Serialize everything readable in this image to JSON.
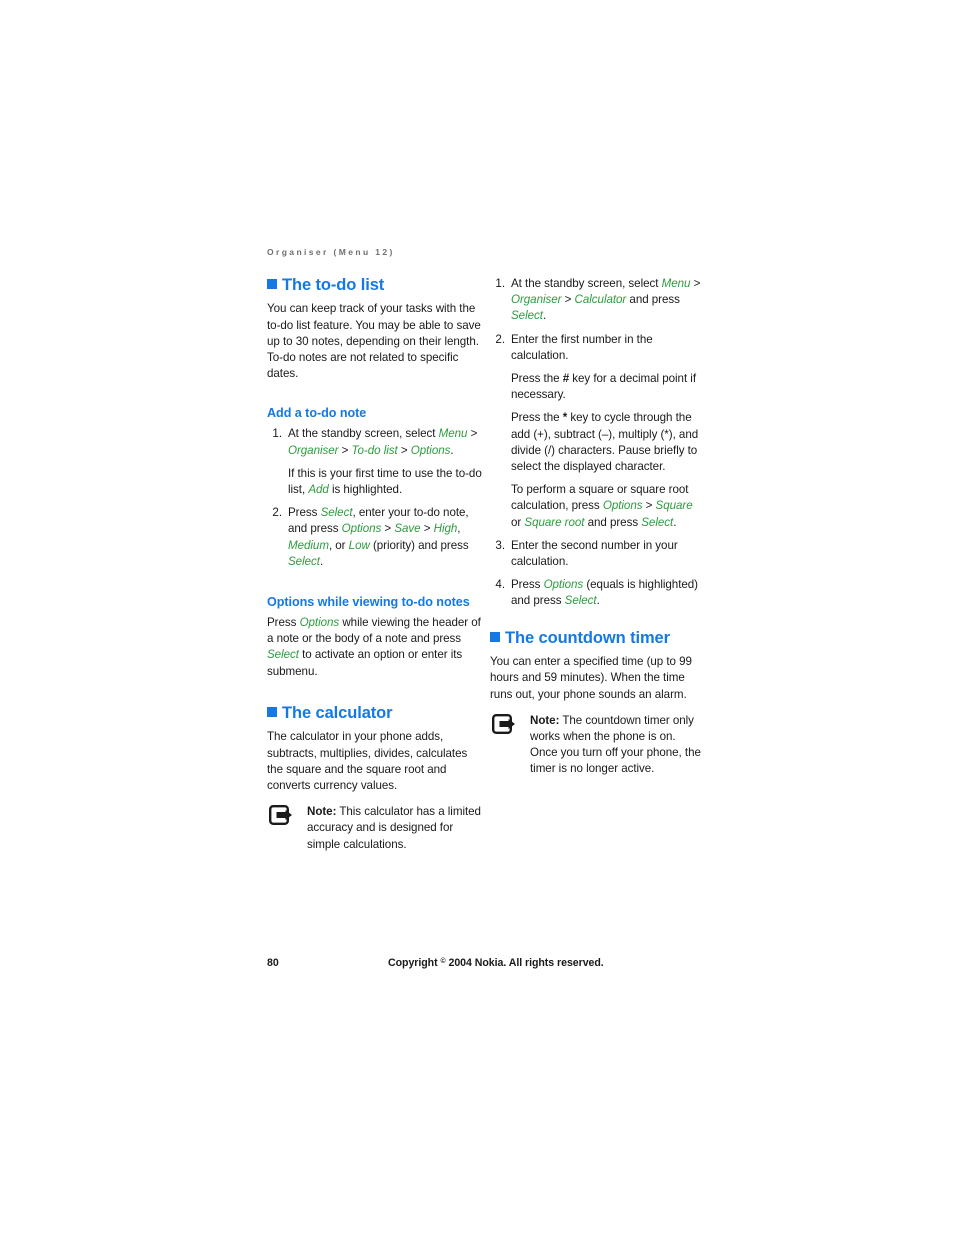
{
  "page": {
    "running_header": "Organiser (Menu 12)",
    "page_number": "80",
    "copyright_prefix": "Copyright ",
    "copyright_symbol": "©",
    "copyright_suffix": " 2004 Nokia. All rights reserved."
  },
  "left_column": {
    "section_todo": {
      "heading": "The to-do list",
      "intro": "You can keep track of your tasks with the to-do list feature. You may be able to save up to 30 notes, depending on their length. To-do notes are not related to specific dates.",
      "sub_add": {
        "heading": "Add a to-do note",
        "step1_lead": "At the standby screen, select ",
        "step1_path_menu": "Menu",
        "step1_sep1": " > ",
        "step1_path_organiser": "Organiser",
        "step1_sep2": " > ",
        "step1_path_todolist": "To-do list",
        "step1_sep3": " > ",
        "step1_path_options": "Options",
        "step1_end": ".",
        "step1_note_a": "If this is your first time to use the to-do list, ",
        "step1_note_add": "Add",
        "step1_note_b": " is highlighted.",
        "step2_a": "Press ",
        "step2_select1": "Select",
        "step2_b": ", enter your to-do note, and press ",
        "step2_options": "Options",
        "step2_c": " > ",
        "step2_save": "Save",
        "step2_d": " > ",
        "step2_high": "High",
        "step2_e": ", ",
        "step2_medium": "Medium",
        "step2_f": ", or ",
        "step2_low": "Low",
        "step2_g": " (priority) and press ",
        "step2_select2": "Select",
        "step2_h": "."
      },
      "sub_options": {
        "heading": "Options while viewing to-do notes",
        "body_a": "Press ",
        "body_options": "Options",
        "body_b": " while viewing the header of a note or the body of a note and press ",
        "body_select": "Select",
        "body_c": " to activate an option or enter its submenu."
      }
    },
    "section_calculator": {
      "heading": "The calculator",
      "intro": "The calculator in your phone adds, subtracts, multiplies, divides, calculates the square and the square root and converts currency values.",
      "note": {
        "label": "Note:",
        "text": " This calculator has a limited accuracy and is designed for simple calculations."
      }
    }
  },
  "right_column": {
    "calculator_steps": {
      "step1_lead": "At the standby screen, select ",
      "step1_path_menu": "Menu",
      "step1_sep1": " > ",
      "step1_path_organiser": "Organiser",
      "step1_sep2": " > ",
      "step1_path_calculator": "Calculator",
      "step1_tail": " and press ",
      "step1_select": "Select",
      "step1_end": ".",
      "step2_main": "Enter the first number in the calculation.",
      "step2_p2_a": "Press the ",
      "step2_p2_hash": "#",
      "step2_p2_b": " key for a decimal point if necessary.",
      "step2_p3_a": "Press the ",
      "step2_p3_star": "*",
      "step2_p3_b": " key to cycle through the add (+), subtract (–), multiply (*), and divide (/) characters. Pause briefly to select the displayed character.",
      "step2_p4_a": "To perform a square or square root calculation, press ",
      "step2_p4_options": "Options",
      "step2_p4_b": " > ",
      "step2_p4_square": "Square",
      "step2_p4_c": " or ",
      "step2_p4_squareroot": "Square root",
      "step2_p4_d": " and press ",
      "step2_p4_select": "Select",
      "step2_p4_e": ".",
      "step3_main": "Enter the second number in your calculation.",
      "step4_a": "Press ",
      "step4_options": "Options",
      "step4_b": " (equals is highlighted) and press ",
      "step4_select": "Select",
      "step4_c": "."
    },
    "section_countdown": {
      "heading": "The countdown timer",
      "intro": "You can enter a specified time (up to 99 hours and 59 minutes). When the time runs out, your phone sounds an alarm.",
      "note": {
        "label": "Note:",
        "text": " The countdown timer only works when the phone is on. Once you turn off your phone, the timer is no longer active."
      }
    }
  },
  "colors": {
    "heading_blue": "#1479E3",
    "menu_green": "#2E9B3F",
    "header_gray": "#6F6F6F",
    "body_black": "#1A1A1A"
  },
  "icons": {
    "note_icon": "note-arrow-icon",
    "heading_bullet": "square-bullet-icon"
  }
}
